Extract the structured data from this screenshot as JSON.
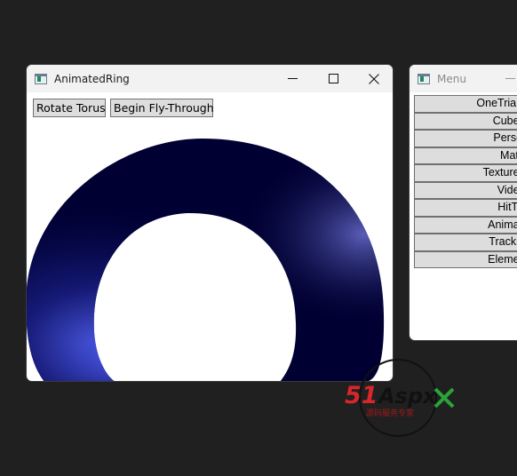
{
  "main_window": {
    "title": "AnimatedRing",
    "buttons": {
      "rotate": "Rotate Torus",
      "fly": "Begin Fly-Through"
    },
    "torus_color": "#000033",
    "highlight_color": "#5a6cff"
  },
  "menu_window": {
    "title": "Menu",
    "items": [
      "OneTriang",
      "CubeM",
      "Person",
      "Mater",
      "TextureM",
      "VideoI",
      "HitTes",
      "Animate",
      "Trackba",
      "Element"
    ]
  },
  "watermark": {
    "brand": "51Aspx",
    "tagline": "源码服务专家"
  },
  "icons": {
    "app": "wpf-window-icon",
    "minimize": "minimize-icon",
    "maximize": "maximize-icon",
    "close": "close-icon"
  }
}
